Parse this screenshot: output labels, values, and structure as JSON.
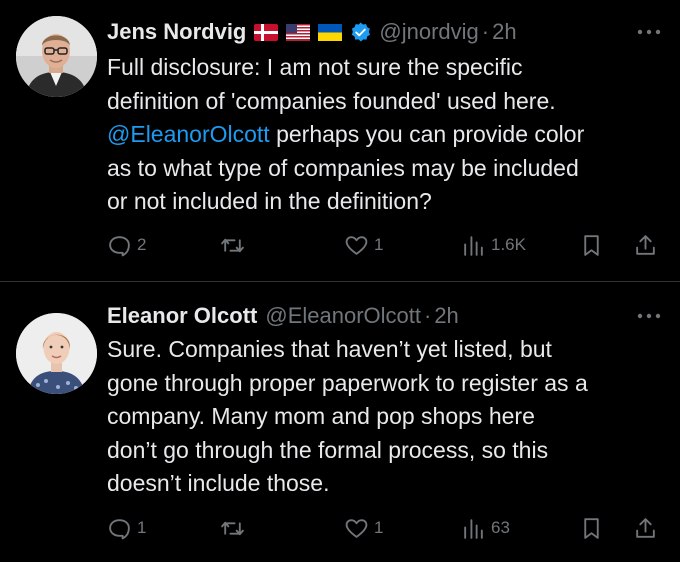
{
  "tweets": [
    {
      "name": "Jens Nordvig",
      "flags": [
        "denmark-flag",
        "usa-flag",
        "ukraine-flag"
      ],
      "verified": true,
      "handle": "@jnordvig",
      "separator": "·",
      "time": "2h",
      "text_lines": [
        {
          "parts": [
            {
              "t": "Full disclosure: I am not sure the specific",
              "mention": false
            }
          ]
        },
        {
          "parts": [
            {
              "t": "definition of 'companies founded' used here.",
              "mention": false
            }
          ]
        },
        {
          "parts": [
            {
              "t": "@EleanorOlcott",
              "mention": true
            },
            {
              "t": " perhaps you can provide color",
              "mention": false
            }
          ]
        },
        {
          "parts": [
            {
              "t": "as to what type of companies may be included",
              "mention": false
            }
          ]
        },
        {
          "parts": [
            {
              "t": "or not included in the definition?",
              "mention": false
            }
          ]
        }
      ],
      "replies": "2",
      "retweets": "",
      "likes": "1",
      "views": "1.6K"
    },
    {
      "name": "Eleanor Olcott",
      "flags": [],
      "verified": false,
      "handle": "@EleanorOlcott",
      "separator": "·",
      "time": "2h",
      "text_lines": [
        {
          "parts": [
            {
              "t": "Sure. Companies that haven’t yet listed, but",
              "mention": false
            }
          ]
        },
        {
          "parts": [
            {
              "t": "gone through proper paperwork to register as a",
              "mention": false
            }
          ]
        },
        {
          "parts": [
            {
              "t": "company. Many mom and pop shops here",
              "mention": false
            }
          ]
        },
        {
          "parts": [
            {
              "t": "don’t go through the formal process, so this",
              "mention": false
            }
          ]
        },
        {
          "parts": [
            {
              "t": "doesn’t include those.",
              "mention": false
            }
          ]
        }
      ],
      "replies": "1",
      "retweets": "",
      "likes": "1",
      "views": "63"
    }
  ],
  "colors": {
    "background": "#000000",
    "text": "#e7e9ea",
    "secondary": "#71767b",
    "accent": "#1d9bf0",
    "divider": "#2f3336"
  }
}
